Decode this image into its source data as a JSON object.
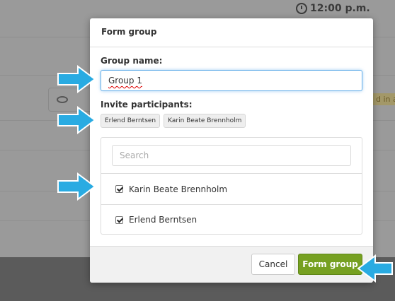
{
  "background": {
    "time": "12:00 p.m.",
    "side_text": "d in as"
  },
  "modal": {
    "title": "Form group",
    "group_name_label": "Group name:",
    "group_name_value": "Group 1",
    "invite_label": "Invite participants:",
    "invited_chips": [
      "Erlend Berntsen",
      "Karin Beate Brennholm"
    ],
    "search_placeholder": "Search",
    "participants": [
      {
        "name": "Karin Beate Brennholm",
        "checked": true
      },
      {
        "name": "Erlend Berntsen",
        "checked": true
      }
    ],
    "cancel_label": "Cancel",
    "submit_label": "Form group"
  },
  "colors": {
    "arrow": "#29abe2",
    "submit_button": "#76a021",
    "input_focus": "#66afe9"
  }
}
